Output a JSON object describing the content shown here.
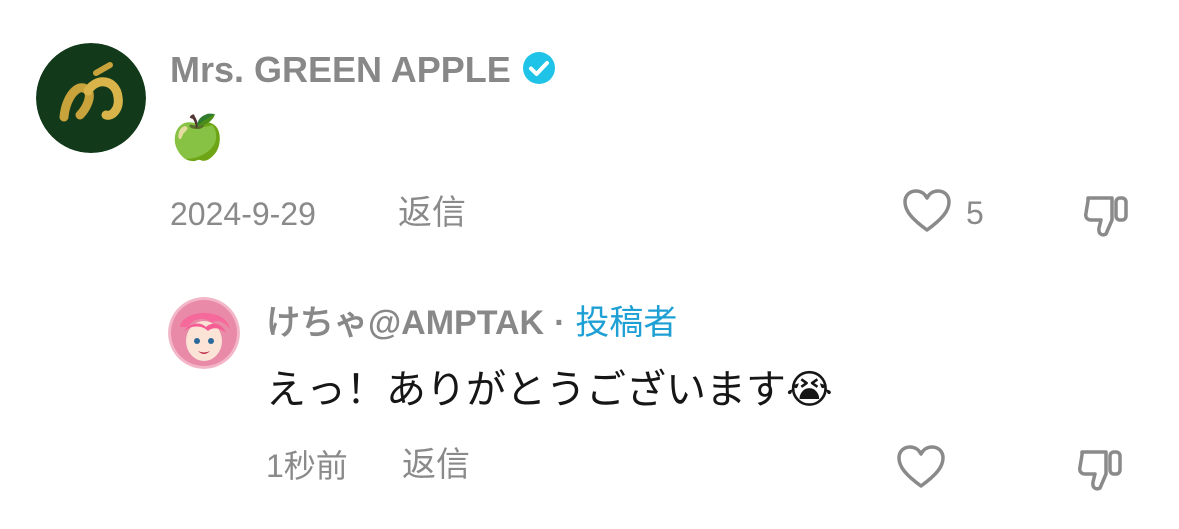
{
  "comments": [
    {
      "username": "Mrs. GREEN APPLE",
      "verified": true,
      "text": "🍏",
      "date": "2024-9-29",
      "reply_label": "返信",
      "like_count": "5"
    },
    {
      "username": "けちゃ@AMPTAK",
      "separator": "·",
      "author_badge": "投稿者",
      "text": "えっ！ありがとうございます😭",
      "date": "1秒前",
      "reply_label": "返信"
    }
  ],
  "colors": {
    "verified_badge": "#20c3e8",
    "author_badge": "#1ea0d5",
    "meta_text": "#8a8a8a"
  }
}
